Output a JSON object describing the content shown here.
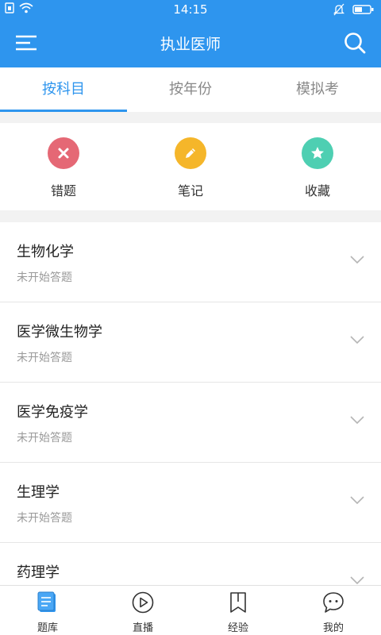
{
  "status_bar": {
    "time": "14:15"
  },
  "app_bar": {
    "title": "执业医师"
  },
  "tabs": [
    {
      "label": "按科目",
      "active": true
    },
    {
      "label": "按年份",
      "active": false
    },
    {
      "label": "模拟考",
      "active": false
    }
  ],
  "quick_actions": [
    {
      "label": "错题",
      "icon": "close-icon",
      "color": "#e56875"
    },
    {
      "label": "笔记",
      "icon": "pencil-icon",
      "color": "#f5b62a"
    },
    {
      "label": "收藏",
      "icon": "star-icon",
      "color": "#4ecfb2"
    }
  ],
  "subjects": [
    {
      "name": "生物化学",
      "status": "未开始答题"
    },
    {
      "name": "医学微生物学",
      "status": "未开始答题"
    },
    {
      "name": "医学免疫学",
      "status": "未开始答题"
    },
    {
      "name": "生理学",
      "status": "未开始答题"
    },
    {
      "name": "药理学",
      "status": ""
    }
  ],
  "bottom_nav": [
    {
      "label": "题库",
      "icon": "question-bank-icon",
      "active": true
    },
    {
      "label": "直播",
      "icon": "play-icon",
      "active": false
    },
    {
      "label": "经验",
      "icon": "bookmark-icon",
      "active": false
    },
    {
      "label": "我的",
      "icon": "chat-bubble-icon",
      "active": false
    }
  ],
  "colors": {
    "primary": "#2e95ee"
  }
}
